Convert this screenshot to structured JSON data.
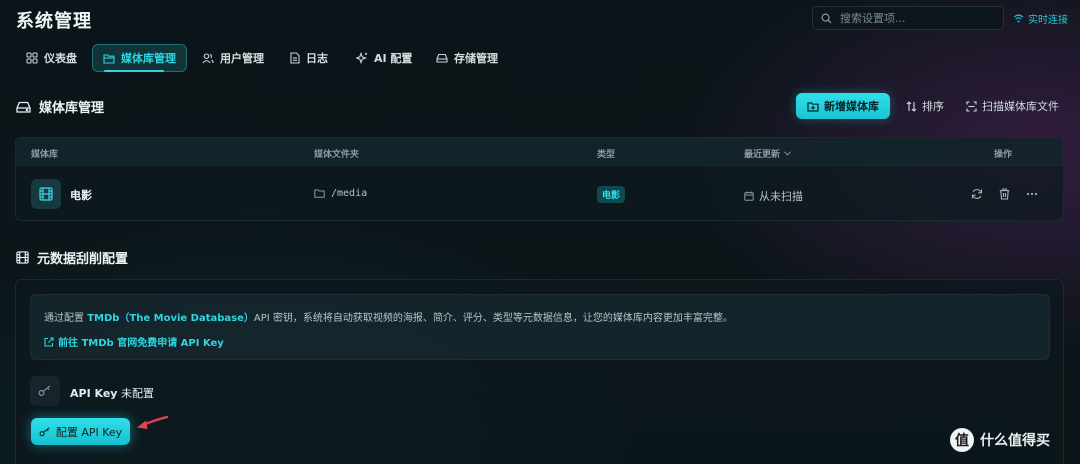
{
  "header": {
    "title": "系统管理",
    "search_placeholder": "搜索设置项...",
    "live_label": "实时连接"
  },
  "tabs": [
    {
      "label": "仪表盘",
      "icon": "grid-icon"
    },
    {
      "label": "媒体库管理",
      "icon": "folder-icon",
      "active": true
    },
    {
      "label": "用户管理",
      "icon": "users-icon"
    },
    {
      "label": "日志",
      "icon": "file-icon"
    },
    {
      "label": "AI 配置",
      "icon": "sparkle-icon"
    },
    {
      "label": "存储管理",
      "icon": "drive-icon"
    }
  ],
  "library_section": {
    "title": "媒体库管理",
    "add_button": "新增媒体库",
    "sort_button": "排序",
    "scan_button": "扫描媒体库文件"
  },
  "table": {
    "columns": [
      "媒体库",
      "媒体文件夹",
      "类型",
      "最近更新",
      "操作"
    ],
    "rows": [
      {
        "name": "电影",
        "folder": "/media",
        "type": "电影",
        "updated": "从未扫描"
      }
    ]
  },
  "metadata_section": {
    "title": "元数据刮削配置",
    "info_prefix": "通过配置 ",
    "info_highlight": "TMDb（The Movie Database）",
    "info_suffix": "API 密钥，系统将自动获取视频的海报、简介、评分、类型等元数据信息，让您的媒体库内容更加丰富完整。",
    "link_text": "前往 TMDb 官网免费申请 API Key",
    "key_label": "API Key",
    "key_status": "未配置",
    "config_button": "配置 API Key"
  },
  "watermark": {
    "badge": "值",
    "text": "什么值得买"
  },
  "colors": {
    "accent": "#2fd6e1",
    "arrow": "#e8414e"
  }
}
